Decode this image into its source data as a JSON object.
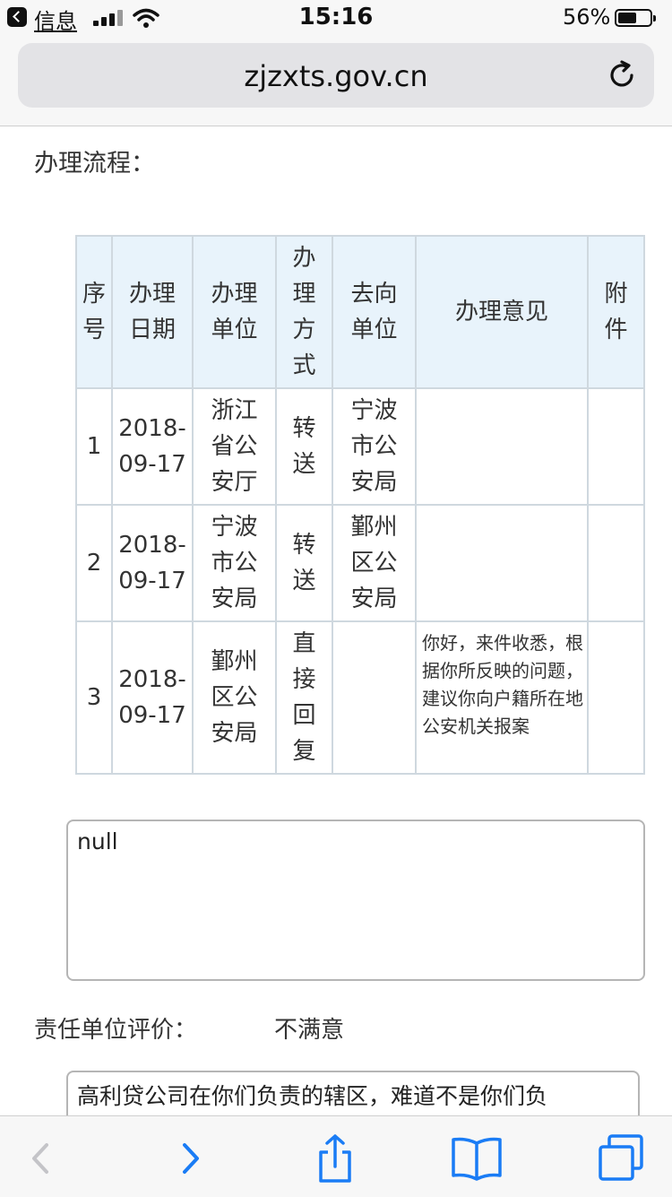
{
  "status_bar": {
    "back_app": "信息",
    "time": "15:16",
    "battery": "56%"
  },
  "browser": {
    "url": "zjzxts.gov.cn"
  },
  "page": {
    "section_title": "办理流程：",
    "table": {
      "headers": [
        "序号",
        "办理日期",
        "办理单位",
        "办理方式",
        "去向单位",
        "办理意见",
        "附件"
      ],
      "rows": [
        {
          "no": "1",
          "date": "2018-09-17",
          "unit": "浙江省公安厅",
          "method": "转送",
          "dest": "宁波市公安局",
          "opinion": "",
          "attachment": ""
        },
        {
          "no": "2",
          "date": "2018-09-17",
          "unit": "宁波市公安局",
          "method": "转送",
          "dest": "鄞州区公安局",
          "opinion": "",
          "attachment": ""
        },
        {
          "no": "3",
          "date": "2018-09-17",
          "unit": "鄞州区公安局",
          "method": "直接回复",
          "dest": "",
          "opinion": "你好，来件收悉，根据你所反映的问题，建议你向户籍所在地公安机关报案",
          "attachment": ""
        }
      ]
    },
    "reply_box": "null",
    "evaluation": {
      "label": "责任单位评价：",
      "value": "不满意"
    },
    "comment_box": "高利贷公司在你们负责的辖区，难道不是你们负"
  },
  "toolbar": {
    "items": [
      "back-icon",
      "forward-icon",
      "share-icon",
      "bookmarks-icon",
      "tabs-icon"
    ]
  }
}
